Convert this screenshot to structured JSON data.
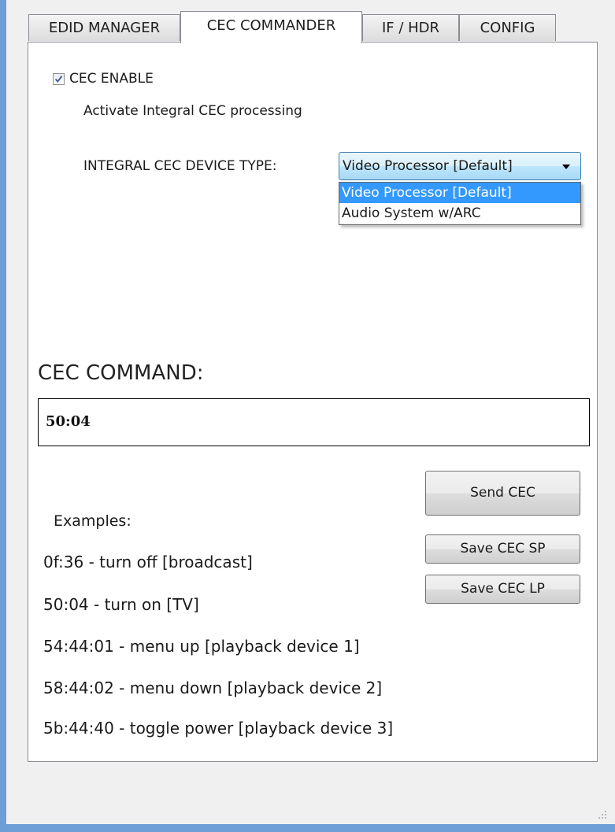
{
  "tabs": [
    {
      "label": "EDID MANAGER",
      "active": false
    },
    {
      "label": "CEC COMMANDER",
      "active": true
    },
    {
      "label": "IF / HDR",
      "active": false
    },
    {
      "label": "CONFIG",
      "active": false
    }
  ],
  "cec_enable": {
    "label": "CEC ENABLE",
    "checked": true
  },
  "description": "Activate Integral CEC processing",
  "device_type": {
    "label": "INTEGRAL CEC DEVICE TYPE:",
    "selected": "Video Processor [Default]",
    "options": [
      "Video Processor [Default]",
      "Audio System w/ARC"
    ]
  },
  "command": {
    "title": "CEC COMMAND:",
    "value": "50:04"
  },
  "buttons": {
    "send": "Send CEC",
    "save_sp": "Save CEC SP",
    "save_lp": "Save CEC LP"
  },
  "examples": {
    "title": "Examples:",
    "items": [
      "0f:36 - turn off [broadcast]",
      "50:04 - turn on [TV]",
      "54:44:01 - menu up [playback device 1]",
      "58:44:02 - menu down [playback device 2]",
      "5b:44:40 - toggle power [playback device 3]"
    ]
  },
  "colors": {
    "window_frame": "#6e9ed6",
    "selection": "#3399ff",
    "combo_border": "#3c7fb1"
  },
  "icons": {
    "checkbox_mark": "checkmark-icon",
    "combo_arrow": "chevron-down-icon",
    "resize_grip": "resize-grip-icon"
  }
}
